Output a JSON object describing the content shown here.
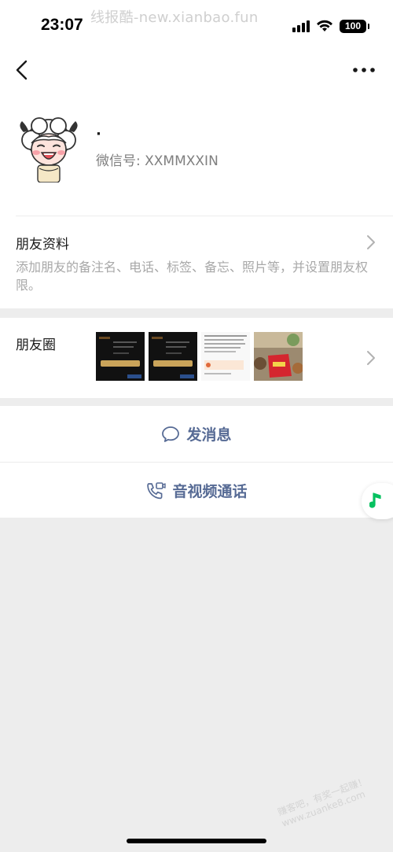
{
  "status_bar": {
    "time": "23:07",
    "watermark": "线报酷-new.xianbao.fun",
    "battery": "100",
    "icons": [
      "signal-icon",
      "wifi-icon",
      "battery-icon"
    ]
  },
  "nav": {
    "back_icon": "back-chevron-icon",
    "more_icon": "more-dots-icon"
  },
  "profile": {
    "nickname": "·",
    "wechat_id": "微信号: XXMMXXIN",
    "avatar": "cartoon-sheep-avatar"
  },
  "friend_info": {
    "title": "朋友资料",
    "description": "添加朋友的备注名、电话、标签、备忘、照片等，并设置朋友权限。"
  },
  "moments": {
    "title": "朋友圈",
    "thumbnails": [
      "dark-screenshot-1",
      "dark-screenshot-2",
      "text-screenshot",
      "snack-photo"
    ]
  },
  "actions": {
    "message_label": "发消息",
    "call_label": "音视频通话"
  },
  "floating": {
    "icon": "music-note-icon"
  },
  "watermark_bottom": {
    "line1": "赚客吧，有奖一起赚！",
    "line2": "www.zuanke8.com"
  },
  "colors": {
    "link_blue": "#576b95",
    "music_green": "#07c160",
    "background": "#ededed"
  }
}
